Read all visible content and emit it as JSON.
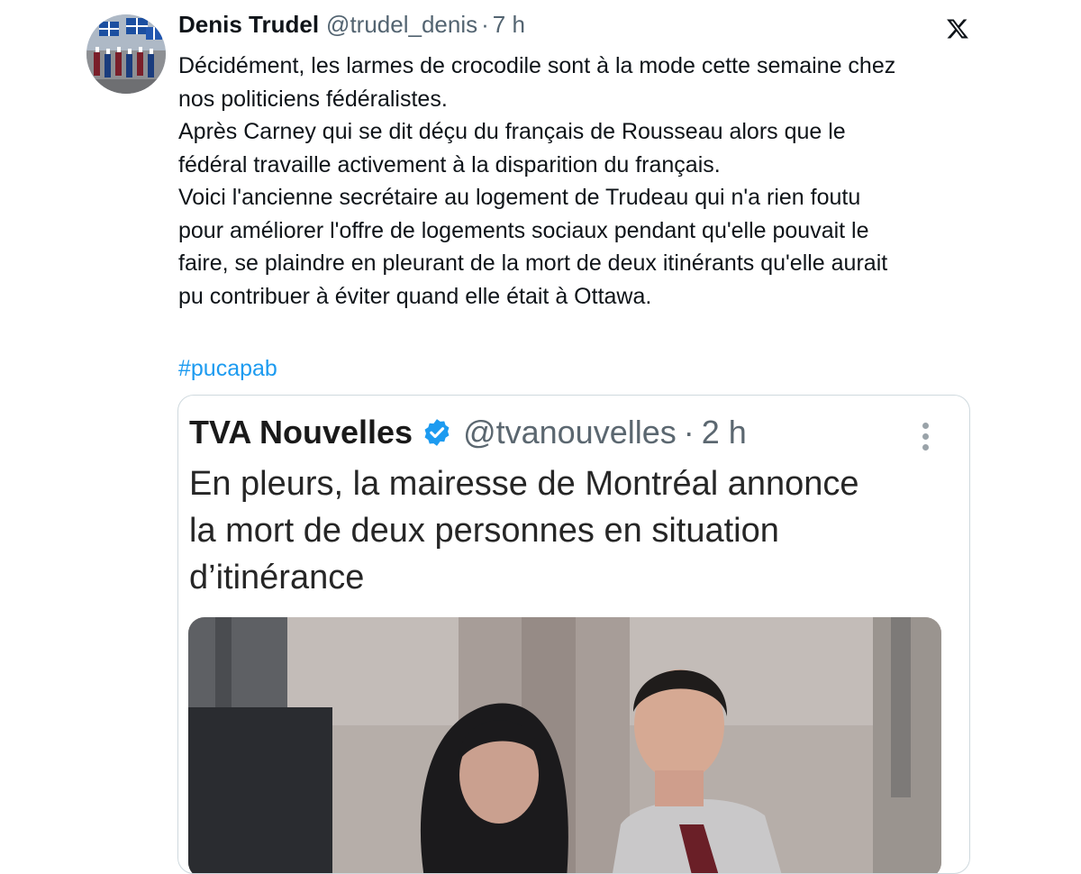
{
  "tweet": {
    "author": {
      "display_name": "Denis Trudel",
      "handle": "@trudel_denis",
      "separator": "·",
      "time": "7 h"
    },
    "platform_icon": "x-logo-icon",
    "text_lines": [
      "Décidément, les larmes de crocodile sont à la mode cette semaine chez",
      "nos politiciens fédéralistes.",
      "Après Carney qui se dit déçu du français de Rousseau alors que le",
      "fédéral travaille activement à la disparition du français.",
      "Voici l'ancienne secrétaire au logement de Trudeau qui n'a rien foutu",
      "pour améliorer l'offre de logements sociaux pendant qu'elle pouvait le",
      "faire, se plaindre en pleurant de la mort de deux itinérants qu'elle aurait",
      "pu contribuer à éviter quand elle était à Ottawa."
    ],
    "hashtag": "#pucapab"
  },
  "quoted_tweet": {
    "display_name": "TVA Nouvelles",
    "verified_icon": "verified-badge-icon",
    "handle": "@tvanouvelles",
    "separator": "·",
    "time": "2 h",
    "more_icon": "more-vertical-icon",
    "headline_lines": [
      "En pleurs, la mairesse de Montréal annonce",
      "la mort de deux personnes en situation",
      "d’itinérance"
    ]
  },
  "colors": {
    "text_primary": "#0f1419",
    "text_secondary": "#536471",
    "link": "#1d9bf0",
    "border": "#cfd9de",
    "verified": "#1d9bf0"
  }
}
